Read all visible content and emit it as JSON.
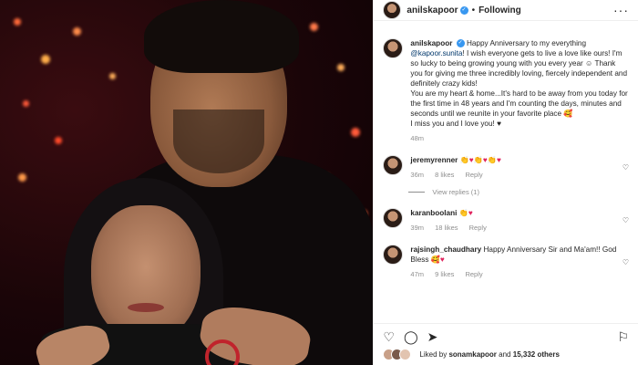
{
  "post": {
    "username": "anilskapoor",
    "follow_status": "Following",
    "caption_user": "anilskapoor",
    "caption_text_1": "Happy Anniversary to my everything ",
    "caption_mention": "@kapoor.sunita",
    "caption_text_2": "! I wish everyone gets to live a love like ours! I'm so lucky to being growing young with you every year ☺ Thank you for giving me three incredibly loving, fiercely independent and definitely crazy kids!",
    "caption_text_3": "You are my heart & home...It's hard to be away from you today for the first time in 48 years and I'm counting the days, minutes and seconds until we reunite in your favorite place 🥰",
    "caption_text_4": "I miss you and I love you! ♥",
    "caption_time": "48m"
  },
  "comments": [
    {
      "user": "jeremyrenner",
      "text_gold": "👏",
      "text_red": "♥",
      "text_gold2": "👏",
      "text_red2": "♥",
      "text_gold3": "👏",
      "text_red3": "♥",
      "time": "36m",
      "likes": "8 likes",
      "reply": "Reply",
      "view_replies": "View replies (1)"
    },
    {
      "user": "karanboolani",
      "text_gold": "👏",
      "text_red": "♥",
      "time": "39m",
      "likes": "18 likes",
      "reply": "Reply"
    },
    {
      "user": "rajsingh_chaudhary",
      "text": "Happy Anniversary Sir and Ma'am!! God Bless ",
      "text_emoji": "🥰♥",
      "time": "47m",
      "likes": "9 likes",
      "reply": "Reply"
    }
  ],
  "footer": {
    "liked_by_prefix": "Liked by",
    "liked_by_user": "sonamkapoor",
    "liked_by_and": "and",
    "liked_by_others": "15,332 others"
  },
  "icons": {
    "more": "more-icon",
    "like": "heart-icon",
    "comment": "comment-icon",
    "share": "share-icon",
    "save": "bookmark-icon"
  }
}
